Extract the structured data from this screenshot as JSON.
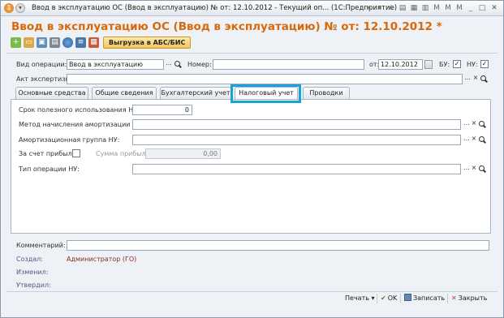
{
  "window": {
    "title": "Ввод в эксплуатацию ОС (Ввод в эксплуатацию) № от: 12.10.2012 - Текущий оп... (1С:Предприятие)"
  },
  "header": {
    "title": "Ввод в эксплуатацию ОС (Ввод в эксплуатацию) № от: 12.10.2012 *",
    "export_button": "Выгрузка в АБС/БИС"
  },
  "form": {
    "operation_label": "Вид операции:",
    "operation_value": "Ввод в эксплуатацию",
    "number_label": "Номер:",
    "number_value": "",
    "date_label": "от:",
    "date_value": "12.10.2012",
    "bu_label": "БУ:",
    "bu_checked": "✓",
    "nu_label": "НУ:",
    "nu_checked": "✓",
    "expertise_label": "Акт экспертизы:",
    "expertise_value": ""
  },
  "tabs": [
    {
      "label": "Основные средства"
    },
    {
      "label": "Общие сведения"
    },
    {
      "label": "Бухгалтерский учет"
    },
    {
      "label": "Налоговый учет"
    },
    {
      "label": "Проводки"
    }
  ],
  "tax": {
    "useful_life_label": "Срок полезного использования НУ:",
    "useful_life_value": "0",
    "depreciation_method_label": "Метод начисления амортизации НУ:",
    "depreciation_method_value": "",
    "depreciation_group_label": "Амортизационная группа НУ:",
    "depreciation_group_value": "",
    "from_profit_label": "За счет прибыли:",
    "profit_sum_label": "Сумма прибыли:",
    "profit_sum_value": "0,00",
    "operation_type_label": "Тип операции НУ:",
    "operation_type_value": ""
  },
  "bottom": {
    "comment_label": "Комментарий:",
    "comment_value": "",
    "created_label": "Создал:",
    "created_value": "Администратор (ГО)",
    "changed_label": "Изменил:",
    "approved_label": "Утвердил:"
  },
  "footer": {
    "print_label": "Печать",
    "ok_label": "OK",
    "save_label": "Записать",
    "close_label": "Закрыть"
  },
  "colors": {
    "title_accent": "#d8690a",
    "tab_highlight": "#17a3d6",
    "user_text": "#8b2a23"
  }
}
